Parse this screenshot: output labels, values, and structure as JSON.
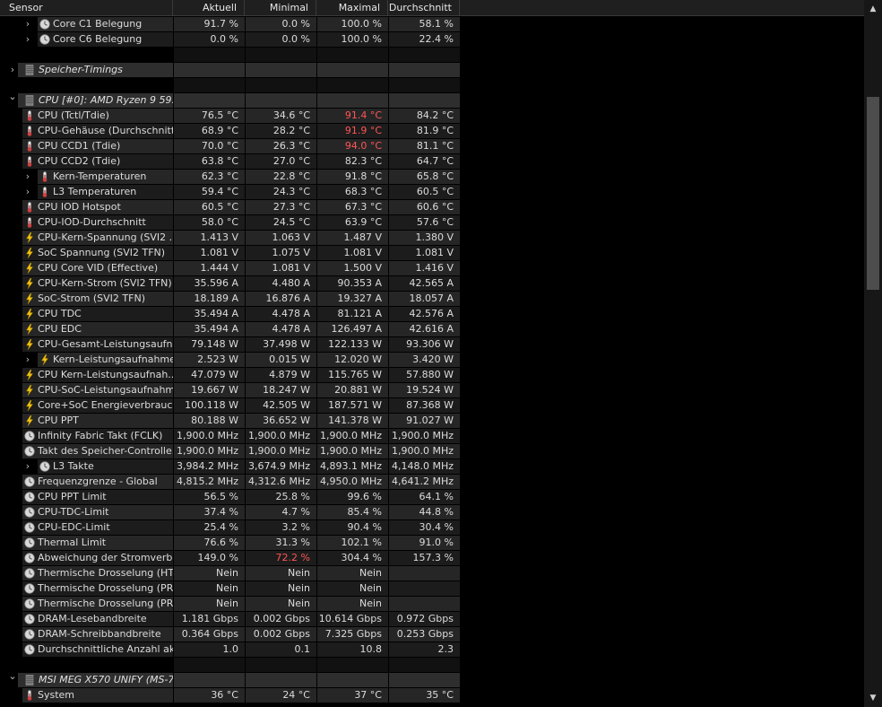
{
  "columns": {
    "sensor": "Sensor",
    "current": "Aktuell",
    "min": "Minimal",
    "max": "Maximal",
    "avg": "Durchschnitt"
  },
  "rows": [
    {
      "type": "item",
      "indent": 2,
      "expand": true,
      "icon": "clock",
      "name": "Core C1 Belegung",
      "v": [
        "91.7 %",
        "0.0 %",
        "100.0 %",
        "58.1 %"
      ]
    },
    {
      "type": "item",
      "indent": 2,
      "expand": true,
      "icon": "clock",
      "name": "Core C6 Belegung",
      "v": [
        "0.0 %",
        "0.0 %",
        "100.0 %",
        "22.4 %"
      ]
    },
    {
      "type": "gap"
    },
    {
      "type": "group",
      "expand": "right",
      "icon": "chip",
      "name": "Speicher-Timings"
    },
    {
      "type": "gap"
    },
    {
      "type": "group",
      "expand": "down",
      "icon": "chip",
      "name": "CPU [#0]: AMD Ryzen 9 59..."
    },
    {
      "type": "item",
      "indent": 1,
      "icon": "thermo",
      "name": "CPU (Tctl/Tdie)",
      "v": [
        "76.5 °C",
        "34.6 °C",
        "91.4 °C",
        "84.2 °C"
      ],
      "red": [
        2
      ]
    },
    {
      "type": "item",
      "indent": 1,
      "icon": "thermo",
      "name": "CPU-Gehäuse (Durchschnitt)",
      "v": [
        "68.9 °C",
        "28.2 °C",
        "91.9 °C",
        "81.9 °C"
      ],
      "red": [
        2
      ]
    },
    {
      "type": "item",
      "indent": 1,
      "icon": "thermo",
      "name": "CPU CCD1 (Tdie)",
      "v": [
        "70.0 °C",
        "26.3 °C",
        "94.0 °C",
        "81.1 °C"
      ],
      "red": [
        2
      ]
    },
    {
      "type": "item",
      "indent": 1,
      "icon": "thermo",
      "name": "CPU CCD2 (Tdie)",
      "v": [
        "63.8 °C",
        "27.0 °C",
        "82.3 °C",
        "64.7 °C"
      ]
    },
    {
      "type": "item",
      "indent": 2,
      "expand": true,
      "icon": "thermo",
      "name": "Kern-Temperaturen",
      "v": [
        "62.3 °C",
        "22.8 °C",
        "91.8 °C",
        "65.8 °C"
      ]
    },
    {
      "type": "item",
      "indent": 2,
      "expand": true,
      "icon": "thermo",
      "name": "L3 Temperaturen",
      "v": [
        "59.4 °C",
        "24.3 °C",
        "68.3 °C",
        "60.5 °C"
      ]
    },
    {
      "type": "item",
      "indent": 1,
      "icon": "thermo",
      "name": "CPU IOD Hotspot",
      "v": [
        "60.5 °C",
        "27.3 °C",
        "67.3 °C",
        "60.6 °C"
      ]
    },
    {
      "type": "item",
      "indent": 1,
      "icon": "thermo",
      "name": "CPU-IOD-Durchschnitt",
      "v": [
        "58.0 °C",
        "24.5 °C",
        "63.9 °C",
        "57.6 °C"
      ]
    },
    {
      "type": "item",
      "indent": 1,
      "icon": "bolt",
      "name": "CPU-Kern-Spannung (SVI2 ...",
      "v": [
        "1.413 V",
        "1.063 V",
        "1.487 V",
        "1.380 V"
      ]
    },
    {
      "type": "item",
      "indent": 1,
      "icon": "bolt",
      "name": "SoC Spannung (SVI2 TFN)",
      "v": [
        "1.081 V",
        "1.075 V",
        "1.081 V",
        "1.081 V"
      ]
    },
    {
      "type": "item",
      "indent": 1,
      "icon": "bolt",
      "name": "CPU Core VID (Effective)",
      "v": [
        "1.444 V",
        "1.081 V",
        "1.500 V",
        "1.416 V"
      ]
    },
    {
      "type": "item",
      "indent": 1,
      "icon": "bolt",
      "name": "CPU-Kern-Strom (SVI2 TFN)",
      "v": [
        "35.596 A",
        "4.480 A",
        "90.353 A",
        "42.565 A"
      ]
    },
    {
      "type": "item",
      "indent": 1,
      "icon": "bolt",
      "name": "SoC-Strom (SVI2 TFN)",
      "v": [
        "18.189 A",
        "16.876 A",
        "19.327 A",
        "18.057 A"
      ]
    },
    {
      "type": "item",
      "indent": 1,
      "icon": "bolt",
      "name": "CPU TDC",
      "v": [
        "35.494 A",
        "4.478 A",
        "81.121 A",
        "42.576 A"
      ]
    },
    {
      "type": "item",
      "indent": 1,
      "icon": "bolt",
      "name": "CPU EDC",
      "v": [
        "35.494 A",
        "4.478 A",
        "126.497 A",
        "42.616 A"
      ]
    },
    {
      "type": "item",
      "indent": 1,
      "icon": "bolt",
      "name": "CPU-Gesamt-Leistungsaufn...",
      "v": [
        "79.148 W",
        "37.498 W",
        "122.133 W",
        "93.306 W"
      ]
    },
    {
      "type": "item",
      "indent": 2,
      "expand": true,
      "icon": "bolt",
      "name": "Kern-Leistungsaufnahmen",
      "v": [
        "2.523 W",
        "0.015 W",
        "12.020 W",
        "3.420 W"
      ]
    },
    {
      "type": "item",
      "indent": 1,
      "icon": "bolt",
      "name": "CPU Kern-Leistungsaufnah...",
      "v": [
        "47.079 W",
        "4.879 W",
        "115.765 W",
        "57.880 W"
      ]
    },
    {
      "type": "item",
      "indent": 1,
      "icon": "bolt",
      "name": "CPU-SoC-Leistungsaufnahm...",
      "v": [
        "19.667 W",
        "18.247 W",
        "20.881 W",
        "19.524 W"
      ]
    },
    {
      "type": "item",
      "indent": 1,
      "icon": "bolt",
      "name": "Core+SoC Energieverbrauc...",
      "v": [
        "100.118 W",
        "42.505 W",
        "187.571 W",
        "87.368 W"
      ]
    },
    {
      "type": "item",
      "indent": 1,
      "icon": "bolt",
      "name": "CPU PPT",
      "v": [
        "80.188 W",
        "36.652 W",
        "141.378 W",
        "91.027 W"
      ]
    },
    {
      "type": "item",
      "indent": 1,
      "icon": "clock",
      "name": "Infinity Fabric Takt (FCLK)",
      "v": [
        "1,900.0 MHz",
        "1,900.0 MHz",
        "1,900.0 MHz",
        "1,900.0 MHz"
      ]
    },
    {
      "type": "item",
      "indent": 1,
      "icon": "clock",
      "name": "Takt des Speicher-Controlle...",
      "v": [
        "1,900.0 MHz",
        "1,900.0 MHz",
        "1,900.0 MHz",
        "1,900.0 MHz"
      ]
    },
    {
      "type": "item",
      "indent": 2,
      "expand": true,
      "icon": "clock",
      "name": "L3 Takte",
      "v": [
        "3,984.2 MHz",
        "3,674.9 MHz",
        "4,893.1 MHz",
        "4,148.0 MHz"
      ]
    },
    {
      "type": "item",
      "indent": 1,
      "icon": "clock",
      "name": "Frequenzgrenze - Global",
      "v": [
        "4,815.2 MHz",
        "4,312.6 MHz",
        "4,950.0 MHz",
        "4,641.2 MHz"
      ]
    },
    {
      "type": "item",
      "indent": 1,
      "icon": "clock",
      "name": "CPU PPT Limit",
      "v": [
        "56.5 %",
        "25.8 %",
        "99.6 %",
        "64.1 %"
      ]
    },
    {
      "type": "item",
      "indent": 1,
      "icon": "clock",
      "name": "CPU-TDC-Limit",
      "v": [
        "37.4 %",
        "4.7 %",
        "85.4 %",
        "44.8 %"
      ]
    },
    {
      "type": "item",
      "indent": 1,
      "icon": "clock",
      "name": "CPU-EDC-Limit",
      "v": [
        "25.4 %",
        "3.2 %",
        "90.4 %",
        "30.4 %"
      ]
    },
    {
      "type": "item",
      "indent": 1,
      "icon": "clock",
      "name": "Thermal Limit",
      "v": [
        "76.6 %",
        "31.3 %",
        "102.1 %",
        "91.0 %"
      ]
    },
    {
      "type": "item",
      "indent": 1,
      "icon": "clock",
      "name": "Abweichung der Stromverbr...",
      "v": [
        "149.0 %",
        "72.2 %",
        "304.4 %",
        "157.3 %"
      ],
      "red": [
        1
      ]
    },
    {
      "type": "item",
      "indent": 1,
      "icon": "clock",
      "name": "Thermische Drosselung (HTC)",
      "v": [
        "Nein",
        "Nein",
        "Nein",
        ""
      ]
    },
    {
      "type": "item",
      "indent": 1,
      "icon": "clock",
      "name": "Thermische Drosselung (PR...",
      "v": [
        "Nein",
        "Nein",
        "Nein",
        ""
      ]
    },
    {
      "type": "item",
      "indent": 1,
      "icon": "clock",
      "name": "Thermische Drosselung (PR...",
      "v": [
        "Nein",
        "Nein",
        "Nein",
        ""
      ]
    },
    {
      "type": "item",
      "indent": 1,
      "icon": "clock",
      "name": "DRAM-Lesebandbreite",
      "v": [
        "1.181 Gbps",
        "0.002 Gbps",
        "10.614 Gbps",
        "0.972 Gbps"
      ]
    },
    {
      "type": "item",
      "indent": 1,
      "icon": "clock",
      "name": "DRAM-Schreibbandbreite",
      "v": [
        "0.364 Gbps",
        "0.002 Gbps",
        "7.325 Gbps",
        "0.253 Gbps"
      ]
    },
    {
      "type": "item",
      "indent": 1,
      "icon": "clock",
      "name": "Durchschnittliche Anzahl akt...",
      "v": [
        "1.0",
        "0.1",
        "10.8",
        "2.3"
      ]
    },
    {
      "type": "gap"
    },
    {
      "type": "group",
      "expand": "down",
      "icon": "chip",
      "name": "MSI MEG X570 UNIFY (MS-7..."
    },
    {
      "type": "item",
      "indent": 1,
      "icon": "thermo",
      "name": "System",
      "v": [
        "36 °C",
        "24 °C",
        "37 °C",
        "35 °C"
      ]
    }
  ],
  "colors": {
    "alert": "#ff5555"
  },
  "scrollbar": {
    "up": "▲",
    "down": "▼"
  }
}
